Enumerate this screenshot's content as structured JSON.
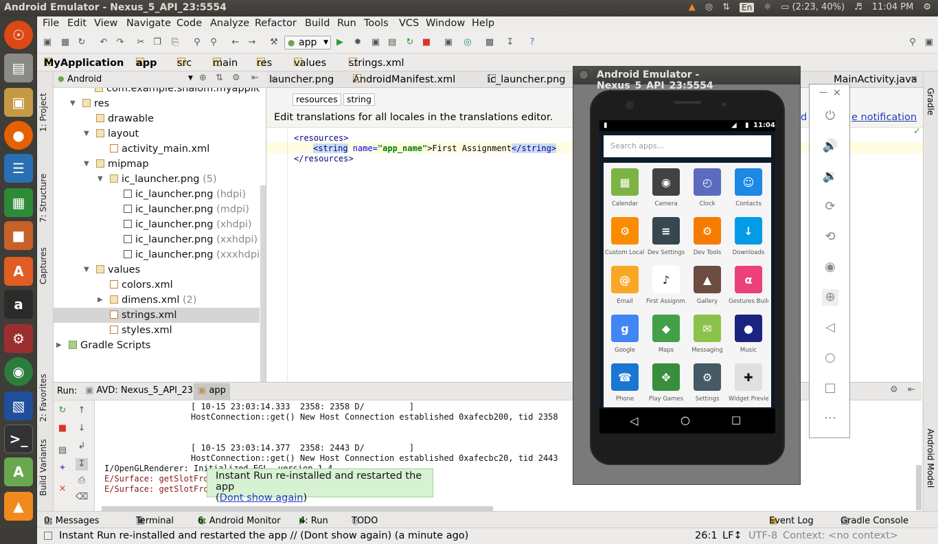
{
  "topbar": {
    "title": "Android Emulator - Nexus_5_API_23:5554",
    "lang": "En",
    "battery": "(2:23, 40%)",
    "clock": "11:04 PM"
  },
  "menu": [
    "File",
    "Edit",
    "View",
    "Navigate",
    "Code",
    "Analyze",
    "Refactor",
    "Build",
    "Run",
    "Tools",
    "VCS",
    "Window",
    "Help"
  ],
  "toolbar": {
    "run_config": "app"
  },
  "nav": {
    "crumbs": [
      "MyApplication",
      "app",
      "src",
      "main",
      "res",
      "values",
      "strings.xml"
    ]
  },
  "left_tools": {
    "project": "1: Project",
    "structure": "7: Structure",
    "captures": "Captures",
    "favorites": "2: Favorites",
    "build_variants": "Build Variants"
  },
  "project": {
    "view": "Android",
    "rows": [
      {
        "label": "com.example.shalom.myapplicati",
        "extra": ""
      },
      {
        "label": "res",
        "extra": ""
      },
      {
        "label": "drawable",
        "extra": ""
      },
      {
        "label": "layout",
        "extra": ""
      },
      {
        "label": "activity_main.xml",
        "extra": ""
      },
      {
        "label": "mipmap",
        "extra": ""
      },
      {
        "label": "ic_launcher.png",
        "extra": "(5)"
      },
      {
        "label": "ic_launcher.png",
        "extra": "(hdpi)"
      },
      {
        "label": "ic_launcher.png",
        "extra": "(mdpi)"
      },
      {
        "label": "ic_launcher.png",
        "extra": "(xhdpi)"
      },
      {
        "label": "ic_launcher.png",
        "extra": "(xxhdpi)"
      },
      {
        "label": "ic_launcher.png",
        "extra": "(xxxhdpi)"
      },
      {
        "label": "values",
        "extra": ""
      },
      {
        "label": "colors.xml",
        "extra": ""
      },
      {
        "label": "dimens.xml",
        "extra": "(2)"
      },
      {
        "label": "strings.xml",
        "extra": ""
      },
      {
        "label": "styles.xml",
        "extra": ""
      },
      {
        "label": "Gradle Scripts",
        "extra": ""
      }
    ]
  },
  "editor": {
    "tabs": [
      "launcher.png",
      "AndroidManifest.xml",
      "ic_launcher.png",
      "MainActivity.java"
    ],
    "chips": [
      "resources",
      "string"
    ],
    "notice": "Edit translations for all locales in the translations editor.",
    "notice_link1": "d",
    "notice_link2": "e notification",
    "code": {
      "l1": "<resources>",
      "l2_open": "<string",
      "l2_attr": " name=",
      "l2_val": "\"app_name\"",
      "l2_text": ">First Assignment",
      "l2_close": "</string>",
      "l3": "</resources>"
    }
  },
  "run": {
    "label": "Run:",
    "tabs": [
      "AVD: Nexus_5_API_23",
      "app"
    ],
    "log": [
      {
        "text": "[ 10-15 23:03:14.333  2358: 2358 D/         ]",
        "err": false,
        "indent": true
      },
      {
        "text": "HostConnection::get() New Host Connection established 0xafecb200, tid 2358",
        "err": false,
        "indent": true
      },
      {
        "text": "[ 10-15 23:03:14.377  2358: 2443 D/         ]",
        "err": false,
        "indent": true
      },
      {
        "text": "HostConnection::get() New Host Connection established 0xafecbc20, tid 2443",
        "err": false,
        "indent": true
      },
      {
        "text": "I/OpenGLRenderer: Initialized EGL, version 1.4",
        "err": false,
        "indent": false
      },
      {
        "text": "E/Surface: getSlotFromBufferLocked: unknown buffer: 0xaa28b1c0",
        "err": true,
        "indent": false
      },
      {
        "text": "E/Surface: getSlotFrom",
        "err": true,
        "indent": false
      }
    ]
  },
  "toast": {
    "line1": "Instant Run re-installed and restarted the app",
    "open": "(",
    "link": "Dont show again",
    "close": ")"
  },
  "bottom_tabs": {
    "messages": "0: Messages",
    "terminal": "Terminal",
    "monitor": "6: Android Monitor",
    "run": "4: Run",
    "todo": "TODO",
    "event_log": "Event Log",
    "gradle_console": "Gradle Console"
  },
  "status": {
    "message": "Instant Run re-installed and restarted the app // (Dont show again) (a minute ago)",
    "pos": "26:1",
    "lf": "LF↕",
    "enc": "UTF-8",
    "context": "Context: <no context>"
  },
  "right_tools": {
    "gradle": "Gradle",
    "android_model": "Android Model"
  },
  "emulator": {
    "title": "Android Emulator - Nexus_5_API_23:5554",
    "time": "11:04",
    "search_placeholder": "Search apps...",
    "apps": [
      {
        "name": "Calendar",
        "color": "#7cb342",
        "glyph": "▦"
      },
      {
        "name": "Camera",
        "color": "#424242",
        "glyph": "◉"
      },
      {
        "name": "Clock",
        "color": "#5c6bc0",
        "glyph": "◴"
      },
      {
        "name": "Contacts",
        "color": "#1e88e5",
        "glyph": "☺"
      },
      {
        "name": "Custom Locale",
        "color": "#fb8c00",
        "glyph": "⚙"
      },
      {
        "name": "Dev Settings",
        "color": "#37474f",
        "glyph": "≡"
      },
      {
        "name": "Dev Tools",
        "color": "#f57c00",
        "glyph": "⚙"
      },
      {
        "name": "Downloads",
        "color": "#039be5",
        "glyph": "↓"
      },
      {
        "name": "Email",
        "color": "#f9a825",
        "glyph": "@"
      },
      {
        "name": "First Assignm..",
        "color": "#ffffff",
        "glyph": "♪"
      },
      {
        "name": "Gallery",
        "color": "#6d4c41",
        "glyph": "▲"
      },
      {
        "name": "Gestures Build..",
        "color": "#ec407a",
        "glyph": "α"
      },
      {
        "name": "Google",
        "color": "#4285f4",
        "glyph": "g"
      },
      {
        "name": "Maps",
        "color": "#43a047",
        "glyph": "◆"
      },
      {
        "name": "Messaging",
        "color": "#8bc34a",
        "glyph": "✉"
      },
      {
        "name": "Music",
        "color": "#1a237e",
        "glyph": "●"
      },
      {
        "name": "Phone",
        "color": "#1976d2",
        "glyph": "☎"
      },
      {
        "name": "Play Games",
        "color": "#388e3c",
        "glyph": "✥"
      },
      {
        "name": "Settings",
        "color": "#455a64",
        "glyph": "⚙"
      },
      {
        "name": "Widget Preview",
        "color": "#e0e0e0",
        "glyph": "✚"
      }
    ]
  },
  "colors": {
    "accent": "#3d7ac2",
    "toast_bg": "#d7f2d3",
    "link": "#1e3ec0"
  }
}
